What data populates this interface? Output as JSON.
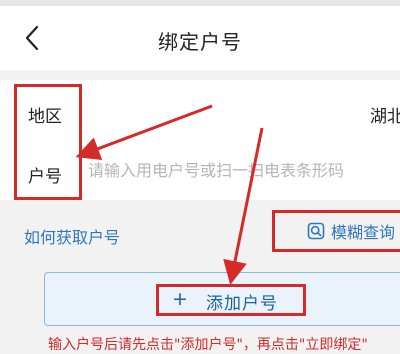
{
  "header": {
    "title": "绑定户号",
    "back_icon": "chevron-left-icon"
  },
  "form": {
    "region_label": "地区",
    "region_value": "湖北",
    "account_label": "户号",
    "account_value": "",
    "account_placeholder": "请输入用电户号或扫一扫电表条形码"
  },
  "helper": {
    "how_link": "如何获取户号",
    "fuzzy_search_label": "模糊查询",
    "fuzzy_search_icon": "search-icon"
  },
  "add_account": {
    "plus": "+",
    "label": "添加户号"
  },
  "notice": "输入户号后请先点击\"添加户号\"，再点击\"立即绑定\"",
  "colors": {
    "highlight": "#d42a2a",
    "link": "#2f77c0",
    "add_text": "#1e5f9e",
    "add_bg": "#eaf3fb"
  }
}
